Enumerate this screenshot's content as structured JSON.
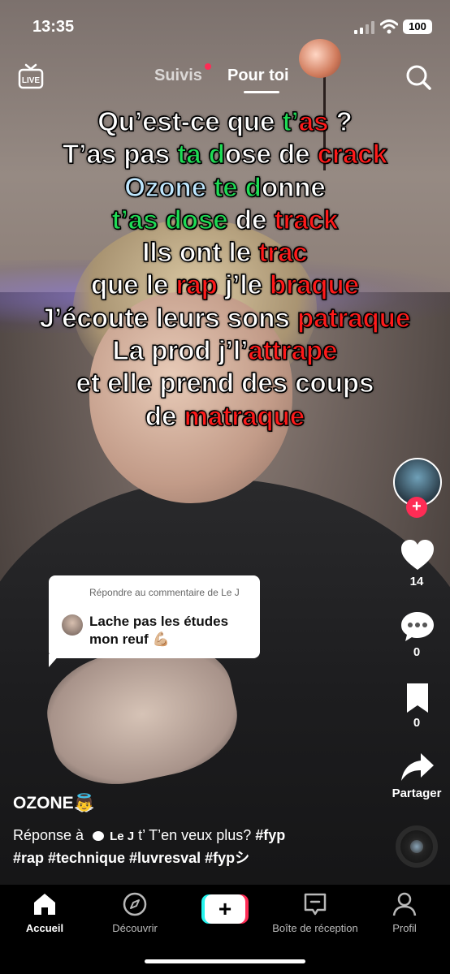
{
  "status_bar": {
    "time": "13:35",
    "battery": "100"
  },
  "top_nav": {
    "live_label": "LIVE",
    "tab_following": "Suivis",
    "tab_for_you": "Pour toi"
  },
  "lyrics": [
    [
      {
        "t": "Qu’est-ce que "
      },
      {
        "t": "t’",
        "c": "green"
      },
      {
        "t": "as",
        "c": "red"
      },
      {
        "t": " ?"
      }
    ],
    [
      {
        "t": "T’as pas "
      },
      {
        "t": "ta",
        "c": "green"
      },
      {
        "t": " "
      },
      {
        "t": "d",
        "c": "green"
      },
      {
        "t": "ose de "
      },
      {
        "t": "crack",
        "c": "red"
      }
    ],
    [
      {
        "t": "Ozone",
        "c": "blue"
      },
      {
        "t": " "
      },
      {
        "t": "te",
        "c": "green"
      },
      {
        "t": " "
      },
      {
        "t": "d",
        "c": "green"
      },
      {
        "t": "onne"
      }
    ],
    [
      {
        "t": "t’as",
        "c": "green"
      },
      {
        "t": " "
      },
      {
        "t": "dose",
        "c": "green"
      },
      {
        "t": " de "
      },
      {
        "t": "track",
        "c": "red"
      }
    ],
    [
      {
        "t": "Ils ont le "
      },
      {
        "t": "trac",
        "c": "red"
      }
    ],
    [
      {
        "t": "que le "
      },
      {
        "t": "rap",
        "c": "red"
      },
      {
        "t": " j’le "
      },
      {
        "t": "braque",
        "c": "red"
      }
    ],
    [
      {
        "t": "J’écoute leurs sons "
      },
      {
        "t": "patraque",
        "c": "red"
      }
    ],
    [
      {
        "t": "La prod j’l’"
      },
      {
        "t": "attrape",
        "c": "red"
      }
    ],
    [
      {
        "t": "et elle prend des coups"
      }
    ],
    [
      {
        "t": "de "
      },
      {
        "t": "matraque",
        "c": "red"
      }
    ]
  ],
  "reply_card": {
    "header": "Répondre au commentaire de Le J",
    "text": "Lache pas les études mon reuf 💪🏼"
  },
  "side_actions": {
    "likes": "14",
    "comments": "0",
    "bookmarks": "0",
    "share_label": "Partager"
  },
  "caption": {
    "username": "OZONE👼",
    "reply_prefix": "Réponse à",
    "mention": "Le J",
    "text": "t’ T’en veux plus?",
    "hashtags_line1": "#fyp",
    "hashtags_line2": "#rap #technique #luvresval #fypシ"
  },
  "bottom_nav": {
    "home": "Accueil",
    "discover": "Découvrir",
    "create": "+",
    "inbox": "Boîte de réception",
    "profile": "Profil"
  },
  "colors": {
    "accent_red": "#fe2c55",
    "accent_cyan": "#25f4ee",
    "lyric_red": "#ff1a1a",
    "lyric_green": "#1fdc55"
  }
}
